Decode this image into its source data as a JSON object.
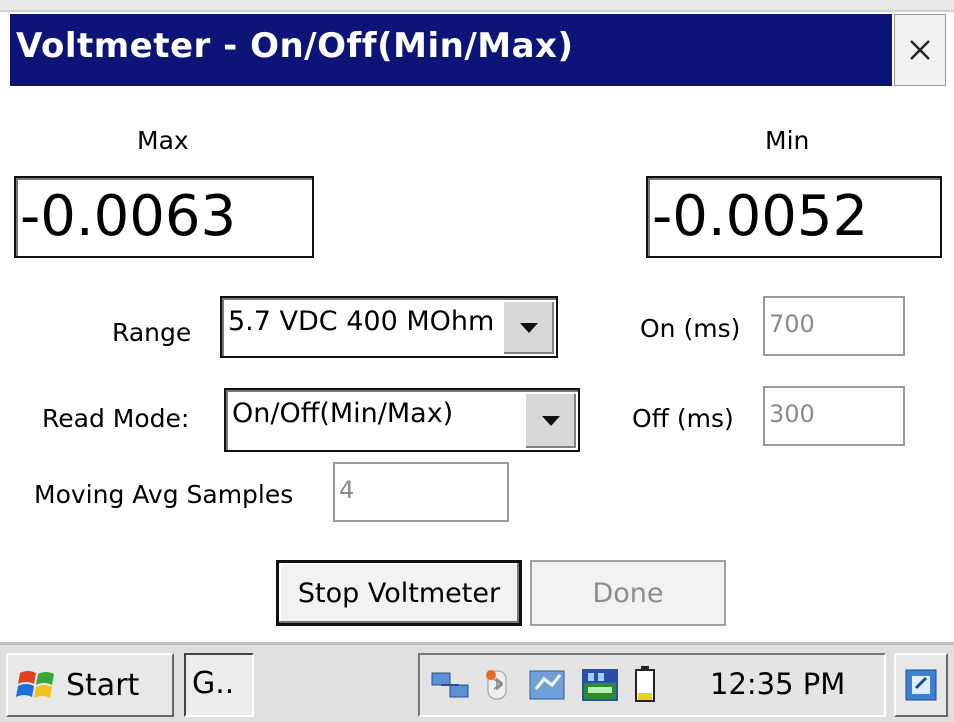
{
  "window": {
    "title": "Voltmeter - On/Off(Min/Max)"
  },
  "readings": {
    "max_label": "Max",
    "max_value": "-0.0063",
    "min_label": "Min",
    "min_value": "-0.0052"
  },
  "settings": {
    "range_label": "Range",
    "range_value": "5.7 VDC 400 MOhm",
    "read_mode_label": "Read Mode:",
    "read_mode_value": "On/Off(Min/Max)",
    "moving_avg_label": "Moving Avg Samples",
    "moving_avg_value": "4",
    "on_label": "On (ms)",
    "on_value": "700",
    "off_label": "Off (ms)",
    "off_value": "300"
  },
  "buttons": {
    "stop_label": "Stop Voltmeter",
    "done_label": "Done"
  },
  "taskbar": {
    "start_label": "Start",
    "task_item_label": "G..",
    "clock": "12:35 PM"
  },
  "colors": {
    "title_bar": "#0c1478",
    "accent_green": "#2e8b2e"
  }
}
